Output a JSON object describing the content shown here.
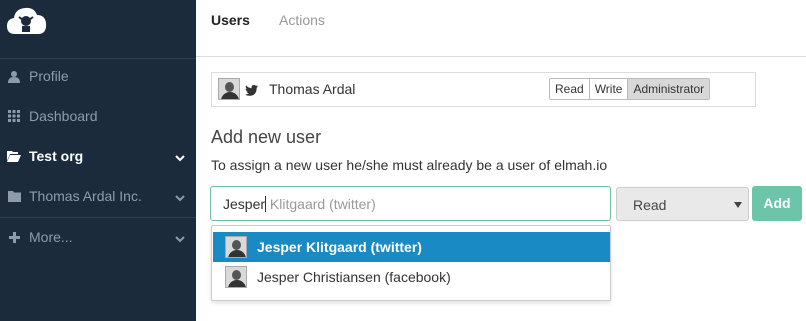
{
  "app": {
    "brand_color": "#1c2b3c",
    "accent": "#6cc4a9",
    "highlight": "#1a8ac4"
  },
  "sidebar": {
    "logo_icon": "cloud-logo-icon",
    "items": [
      {
        "label": "Profile",
        "icon": "user-icon",
        "active": false,
        "has_chevron": false
      },
      {
        "label": "Dashboard",
        "icon": "grid-icon",
        "active": false,
        "has_chevron": false
      },
      {
        "label": "Test org",
        "icon": "folder-open-icon",
        "active": true,
        "has_chevron": true
      },
      {
        "label": "Thomas Ardal Inc.",
        "icon": "folder-icon",
        "active": false,
        "has_chevron": true
      },
      {
        "label": "More...",
        "icon": "plus-icon",
        "active": false,
        "has_chevron": true
      }
    ]
  },
  "tabs": [
    {
      "label": "Users",
      "active": true
    },
    {
      "label": "Actions",
      "active": false
    }
  ],
  "existing_user": {
    "name": "Thomas Ardal",
    "provider_icon": "twitter-icon",
    "roles": [
      "Read",
      "Write",
      "Administrator"
    ],
    "selected_role": "Administrator"
  },
  "add_user": {
    "title": "Add new user",
    "description": "To assign a new user he/she must already be a user of elmah.io",
    "input_typed": "Jesper",
    "input_suggestion": " Klitgaard (twitter)",
    "role_select_value": "Read",
    "add_button_label": "Add",
    "suggestions": [
      {
        "label": "Jesper Klitgaard (twitter)",
        "selected": true
      },
      {
        "label": "Jesper Christiansen (facebook)",
        "selected": false
      }
    ]
  }
}
